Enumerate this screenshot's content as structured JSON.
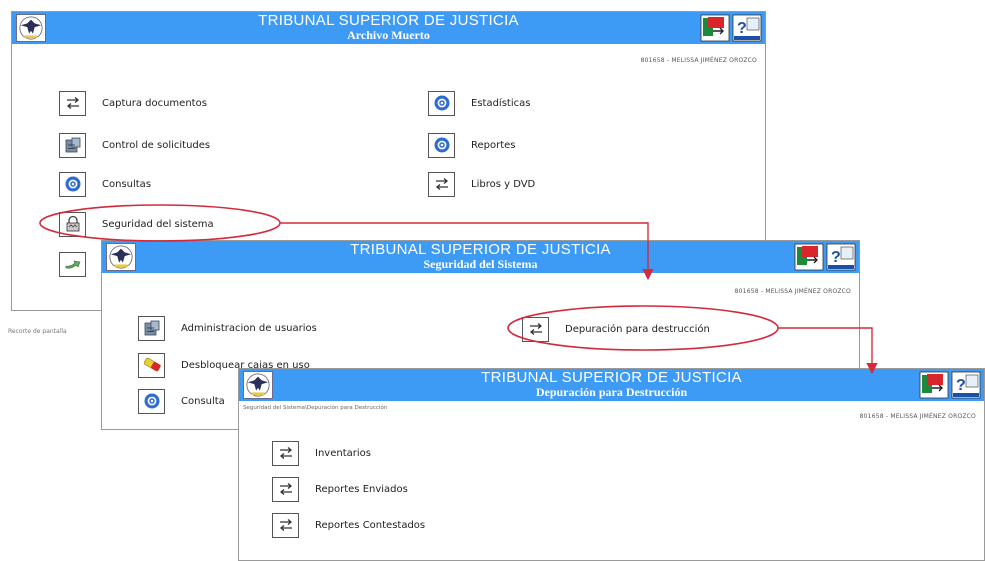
{
  "windows": [
    {
      "title": "TRIBUNAL SUPERIOR DE JUSTICIA",
      "subtitle": "Archivo Muerto",
      "user": "801658 - MELISSA JIMÉNEZ OROZCO",
      "items": [
        {
          "label": "Captura documentos",
          "icon": "swap-arrows-icon"
        },
        {
          "label": "Control de solicitudes",
          "icon": "cabinet-icon"
        },
        {
          "label": "Consultas",
          "icon": "search-icon"
        },
        {
          "label": "Seguridad del sistema",
          "icon": "lock-icon"
        },
        {
          "label": "",
          "icon": "arrow-icon"
        },
        {
          "label": "Estadísticas",
          "icon": "search-icon"
        },
        {
          "label": "Reportes",
          "icon": "search-icon"
        },
        {
          "label": "Libros y DVD",
          "icon": "swap-arrows-icon"
        }
      ]
    },
    {
      "title": "TRIBUNAL SUPERIOR DE JUSTICIA",
      "subtitle": "Seguridad del Sistema",
      "user": "801658 - MELISSA JIMÉNEZ OROZCO",
      "items": [
        {
          "label": "Administracion de usuarios",
          "icon": "cabinet-icon"
        },
        {
          "label": "Desbloquear cajas en uso",
          "icon": "eraser-icon"
        },
        {
          "label": "Consulta",
          "icon": "search-icon"
        },
        {
          "label": "Depuración para destrucción",
          "icon": "swap-arrows-icon"
        }
      ]
    },
    {
      "title": "TRIBUNAL SUPERIOR DE JUSTICIA",
      "subtitle": "Depuración para Destrucción",
      "breadcrumb": "Seguridad del Sistema\\Depuración para Destrucción",
      "user": "801658 - MELISSA JIMÉNEZ OROZCO",
      "items": [
        {
          "label": "Inventarios",
          "icon": "swap-arrows-icon"
        },
        {
          "label": "Reportes Enviados",
          "icon": "swap-arrows-icon"
        },
        {
          "label": "Reportes Contestados",
          "icon": "swap-arrows-icon"
        }
      ]
    }
  ],
  "caption": "Recorte de pantalla",
  "colors": {
    "header": "#3d9bf5",
    "annotation": "#d42a3c"
  }
}
